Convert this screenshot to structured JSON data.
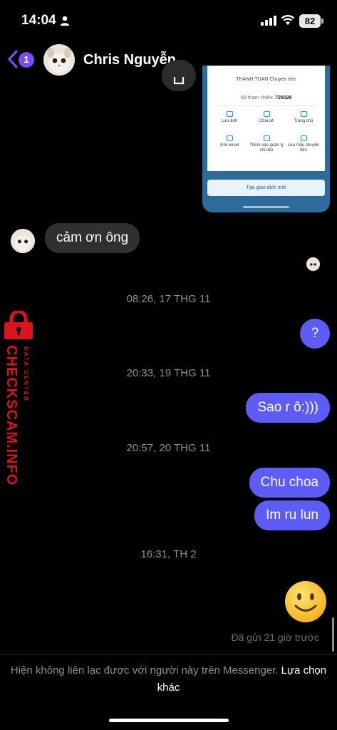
{
  "status_bar": {
    "time": "14:04",
    "battery": "82"
  },
  "header": {
    "unread_count": "1",
    "contact_name": "Chris Nguyễn"
  },
  "shared_image": {
    "recipient_line": "THANH TUAN Chuyen tien",
    "reference_label": "Số tham chiếu:",
    "reference_number": "725028",
    "actions": [
      "Lưu ảnh",
      "Chia sẻ",
      "Trang chủ",
      "Gửi email",
      "Thêm vào quản lý chi tiêu",
      "Lưu mẫu chuyển tiền"
    ],
    "button": "Tạo giao dịch mới"
  },
  "messages": {
    "incoming_1": "cảm ơn ông",
    "ts_1": "08:26, 17 THG 11",
    "question": "?",
    "ts_2": "20:33, 19 THG 11",
    "out_1": "Sao r ô:)))",
    "ts_3": "20:57, 20 THG 11",
    "out_2": "Chu choa",
    "out_3": "Im ru lun",
    "ts_4": "16:31, TH 2",
    "sent_status": "Đã gửi 21 giờ trước"
  },
  "watermark": {
    "main": "CHECKSCAM.INFO",
    "sub": "DATA CENTER"
  },
  "footer": {
    "text": "Hiện không liên lạc được với người này trên Messenger.",
    "link": "Lựa chọn khác"
  },
  "colors": {
    "outgoing_bubble": "#5d5cf7",
    "incoming_bubble": "#303030",
    "accent": "#7a4df2",
    "watermark": "#d9141c"
  },
  "icons": [
    "person-icon",
    "signal-icon",
    "wifi-icon",
    "battery-icon",
    "back-chevron-icon",
    "download-icon",
    "smile-emoji-icon",
    "lock-icon"
  ]
}
